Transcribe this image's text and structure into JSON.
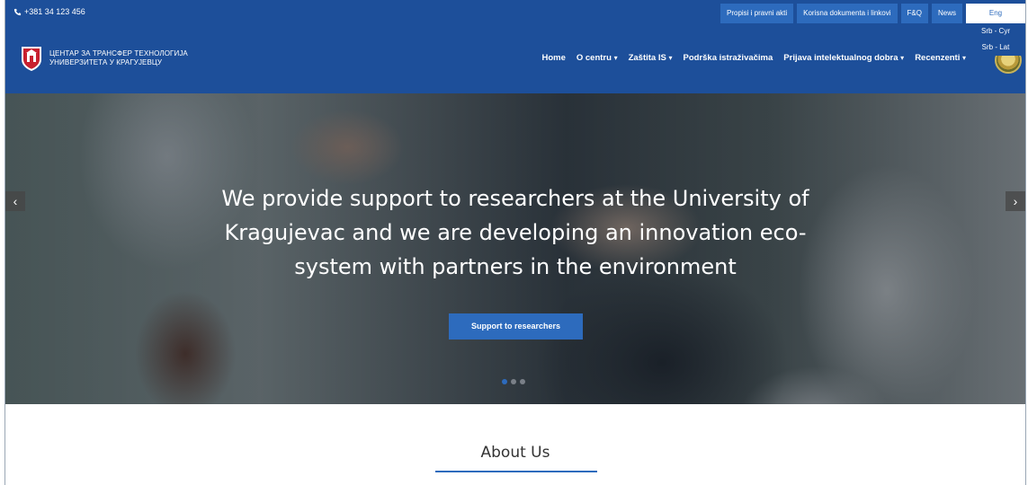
{
  "topbar": {
    "phone": "+381 34 123 456",
    "links": [
      "Propisi i pravni akti",
      "Korisna dokumenta i linkovi",
      "F&Q",
      "News"
    ],
    "language": {
      "current": "Eng",
      "options": [
        "Srb - Cyr",
        "Srb - Lat"
      ]
    }
  },
  "header": {
    "logo_line1": "ЦЕНТАР ЗА ТРАНСФЕР ТЕХНОЛОГИЈА",
    "logo_line2": "УНИВЕРЗИТЕТА У КРАГУЈЕВЦУ",
    "nav": [
      {
        "label": "Home",
        "dropdown": false
      },
      {
        "label": "O centru",
        "dropdown": true
      },
      {
        "label": "Zaštita IS",
        "dropdown": true
      },
      {
        "label": "Podrška istraživačima",
        "dropdown": false
      },
      {
        "label": "Prijava intelektualnog dobra",
        "dropdown": true
      },
      {
        "label": "Recenzenti",
        "dropdown": true
      }
    ]
  },
  "hero": {
    "caption_line1": "We provide support to researchers at the University of",
    "caption_line2": "Kragujevac and we are developing an innovation eco-",
    "caption_line3": "system with partners in the environment",
    "button": "Support to researchers",
    "slide_count": 3,
    "active_slide": 1
  },
  "about": {
    "title": "About Us"
  },
  "colors": {
    "primary": "#1d4f9a",
    "accent": "#2d6bbd"
  }
}
